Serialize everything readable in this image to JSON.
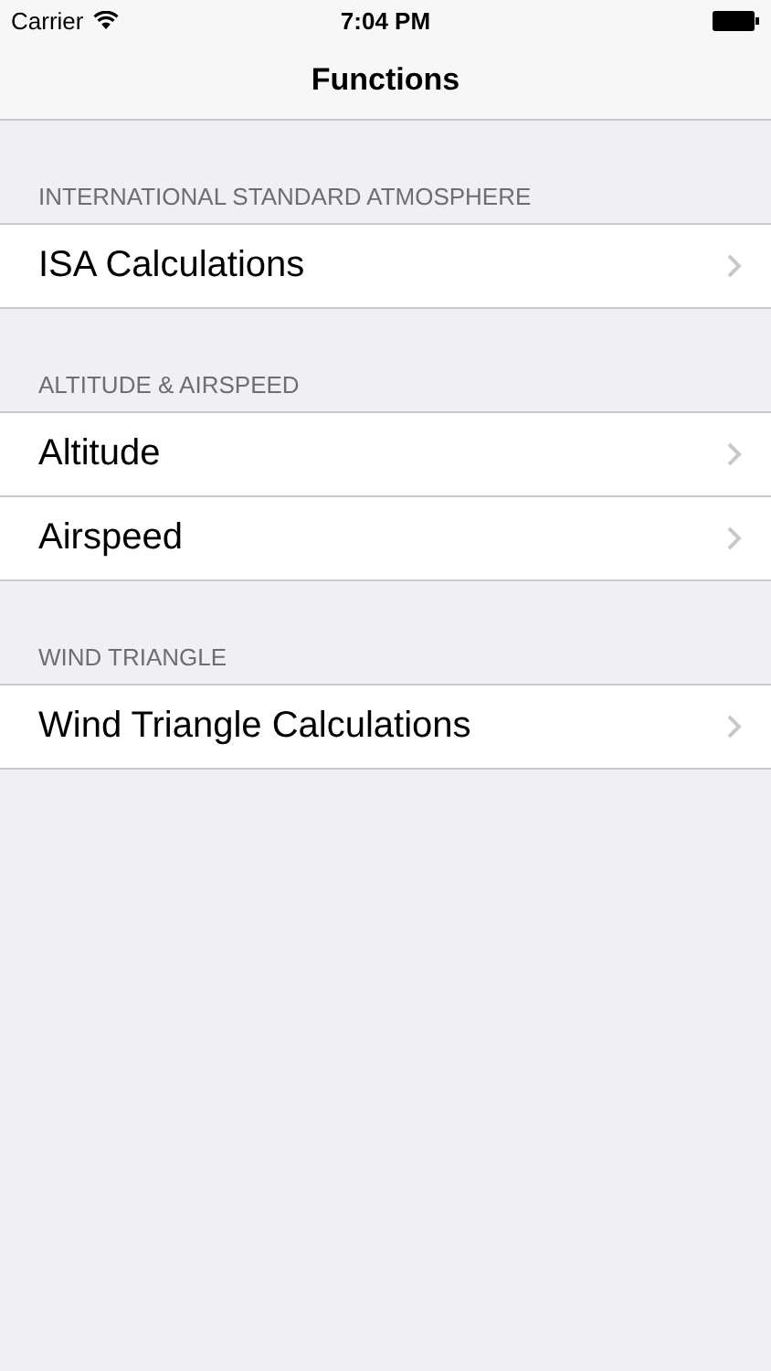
{
  "status_bar": {
    "carrier": "Carrier",
    "time": "7:04 PM"
  },
  "nav_bar": {
    "title": "Functions"
  },
  "sections": [
    {
      "header": "INTERNATIONAL STANDARD ATMOSPHERE",
      "rows": [
        {
          "label": "ISA Calculations"
        }
      ]
    },
    {
      "header": "ALTITUDE & AIRSPEED",
      "rows": [
        {
          "label": "Altitude"
        },
        {
          "label": "Airspeed"
        }
      ]
    },
    {
      "header": "WIND TRIANGLE",
      "rows": [
        {
          "label": "Wind Triangle Calculations"
        }
      ]
    }
  ]
}
